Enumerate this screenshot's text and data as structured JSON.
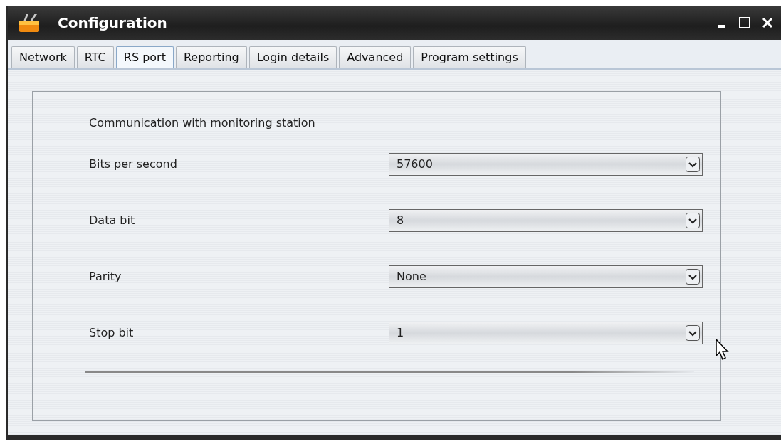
{
  "window": {
    "title": "Configuration"
  },
  "tabs": [
    {
      "label": "Network",
      "selected": false
    },
    {
      "label": "RTC",
      "selected": false
    },
    {
      "label": "RS port",
      "selected": true
    },
    {
      "label": "Reporting",
      "selected": false
    },
    {
      "label": "Login details",
      "selected": false
    },
    {
      "label": "Advanced",
      "selected": false
    },
    {
      "label": "Program settings",
      "selected": false
    }
  ],
  "panel": {
    "heading": "Communication with monitoring station",
    "fields": [
      {
        "label": "Bits per second",
        "value": "57600"
      },
      {
        "label": "Data bit",
        "value": "8"
      },
      {
        "label": "Parity",
        "value": "None"
      },
      {
        "label": "Stop bit",
        "value": "1"
      }
    ]
  }
}
